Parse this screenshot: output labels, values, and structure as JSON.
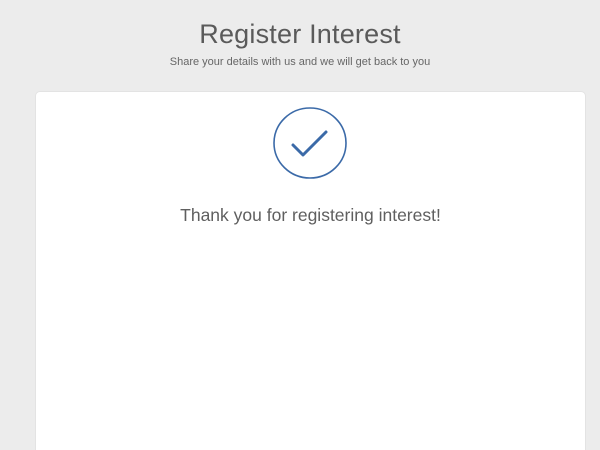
{
  "header": {
    "title": "Register Interest",
    "subtitle": "Share your details with us and we will get back to you"
  },
  "confirmation": {
    "icon": "check-circle-icon",
    "message": "Thank you for registering interest!"
  },
  "colors": {
    "background": "#ececec",
    "card": "#ffffff",
    "accent": "#3b6aa8",
    "text": "#5f5f5f"
  }
}
